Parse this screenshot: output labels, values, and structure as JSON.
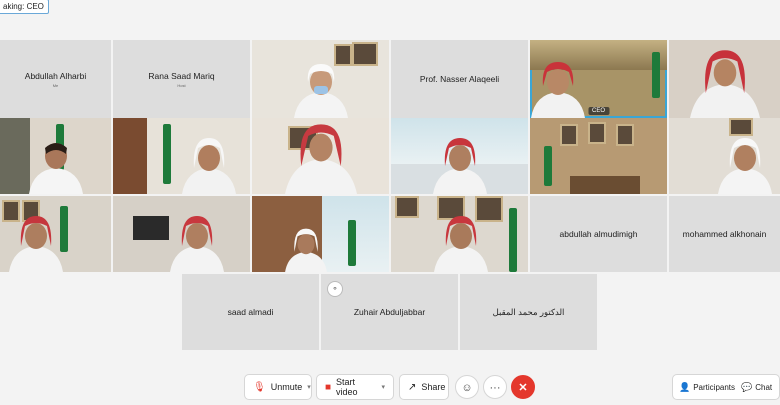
{
  "speaking": {
    "label": "aking: CEO"
  },
  "name_tiles": {
    "alharbi": {
      "name": "Abdullah Alharbi",
      "sub": "Me"
    },
    "mariq": {
      "name": "Rana Saad Mariq",
      "sub": "Host"
    },
    "alaqeeli": {
      "name": "Prof. Nasser Alaqeeli"
    },
    "almudimigh": {
      "name": "abdullah almudimigh"
    },
    "alkhonain": {
      "name": "mohammed alkhonain"
    },
    "almadi": {
      "name": "saad almadi"
    },
    "abduljabbar": {
      "name": "Zuhair Abduljabbar"
    },
    "almuqbil": {
      "name": "الدكتور محمد المقبل"
    }
  },
  "ceo_tile": {
    "tag": "CEO"
  },
  "toolbar": {
    "unmute": "Unmute",
    "start_video": "Start video",
    "share": "Share",
    "participants": "Participants",
    "chat": "Chat"
  },
  "colors": {
    "accent": "#3aa6d6",
    "end_call": "#e4372c",
    "flag": "#1e7a3a"
  },
  "icons": {
    "unmute": "mic-muted-icon",
    "video": "video-camera-icon",
    "share": "share-icon",
    "reactions": "emoji-icon",
    "more": "more-icon",
    "end": "end-call-icon",
    "participants": "participants-icon",
    "chat": "chat-icon"
  }
}
